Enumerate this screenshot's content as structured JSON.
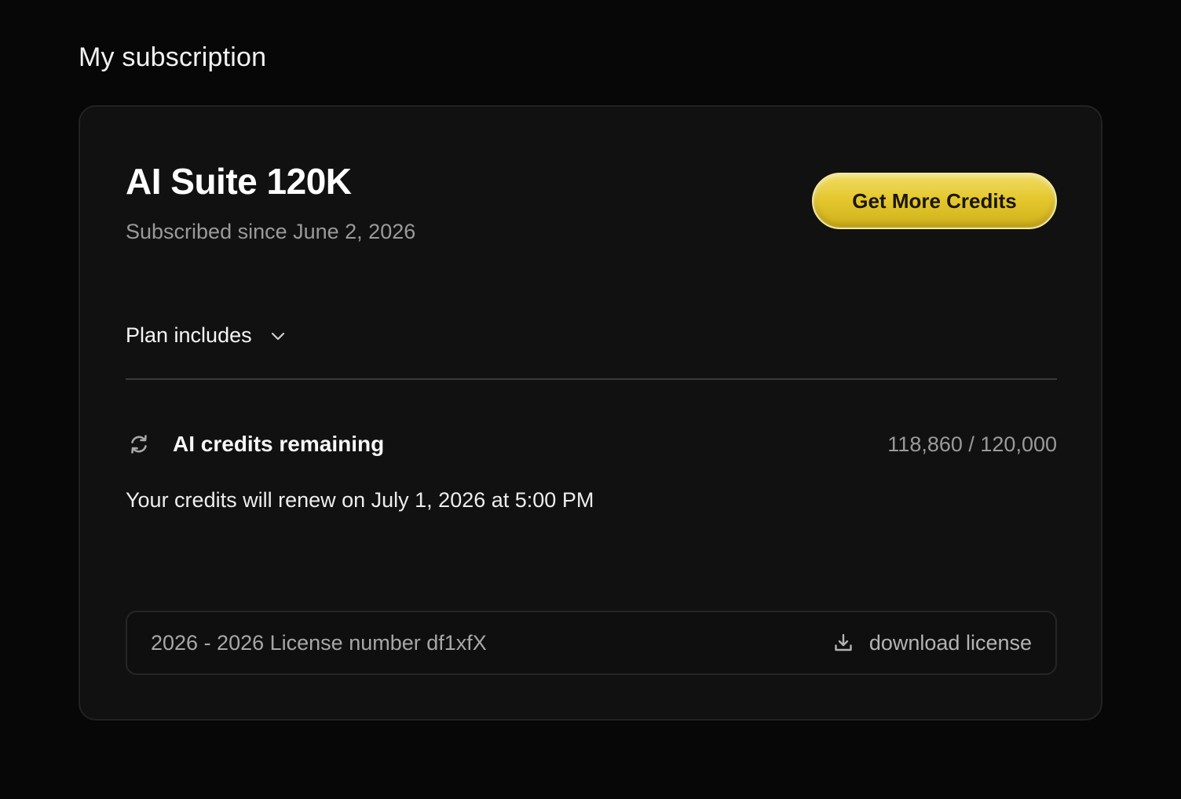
{
  "page": {
    "section_title": "My subscription"
  },
  "plan": {
    "name": "AI Suite 120K",
    "subscribed_since": "Subscribed since June 2, 2026",
    "cta_label": "Get More Credits",
    "includes_label": "Plan includes"
  },
  "credits": {
    "label": "AI credits remaining",
    "value": "118,860 / 120,000",
    "renew_text": "Your credits will renew on July 1, 2026 at 5:00 PM"
  },
  "license": {
    "text": "2026 - 2026 License number df1xfX",
    "download_label": "download license"
  },
  "icons": {
    "chevron": "chevron-down-icon",
    "refresh": "refresh-icon",
    "download": "download-icon"
  },
  "colors": {
    "background": "#070707",
    "card": "#111111",
    "accent_gold": "#e5c82f"
  }
}
